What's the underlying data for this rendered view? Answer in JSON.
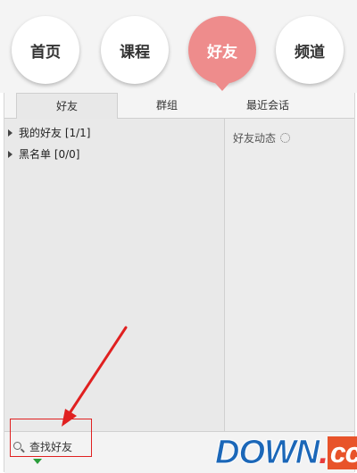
{
  "nav": {
    "items": [
      {
        "label": "首页"
      },
      {
        "label": "课程"
      },
      {
        "label": "好友",
        "active": true
      },
      {
        "label": "频道"
      }
    ]
  },
  "tabs": {
    "items": [
      {
        "label": "好友",
        "active": true
      },
      {
        "label": "群组"
      },
      {
        "label": "最近会话"
      }
    ]
  },
  "friends": {
    "groups": [
      {
        "label": "我的好友 [1/1]"
      },
      {
        "label": "黑名单 [0/0]"
      }
    ]
  },
  "feed": {
    "label": "好友动态"
  },
  "bottom": {
    "find_label": "查找好友"
  },
  "watermark": {
    "part1": "DOWN",
    "part2": ".",
    "part3": "cc"
  },
  "colors": {
    "active_nav": "#ee8c8c",
    "annotation_red": "#e02020",
    "indicator_green": "#2a9d3a"
  }
}
